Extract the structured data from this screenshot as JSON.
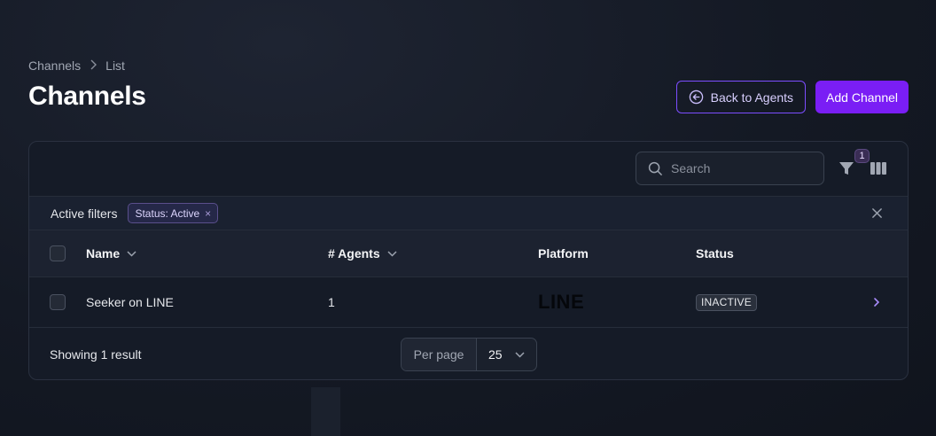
{
  "breadcrumb": {
    "items": [
      "Channels",
      "List"
    ],
    "separator": ">"
  },
  "page": {
    "title": "Channels"
  },
  "actions": {
    "back_label": "Back to Agents",
    "add_label": "Add Channel"
  },
  "search": {
    "placeholder": "Search"
  },
  "filters": {
    "badge_count": "1",
    "label": "Active filters",
    "chips": [
      {
        "label": "Status: Active",
        "remove": "×"
      }
    ]
  },
  "table": {
    "headers": {
      "name": "Name",
      "agents": "# Agents",
      "platform": "Platform",
      "status": "Status"
    },
    "rows": [
      {
        "name": "Seeker on LINE",
        "agents": "1",
        "platform": "LINE",
        "status": "INACTIVE"
      }
    ]
  },
  "footer": {
    "showing": "Showing 1 result",
    "per_page_label": "Per page",
    "per_page_value": "25"
  },
  "colors": {
    "accent": "#7a1ef5",
    "accent_border": "#7c4dff",
    "background": "#141924"
  }
}
